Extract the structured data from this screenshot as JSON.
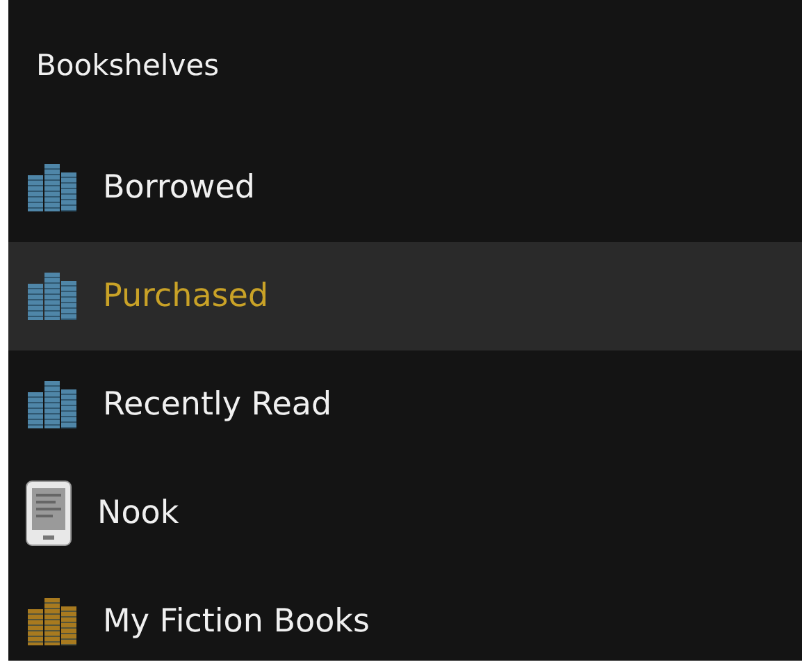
{
  "header": {
    "title": "Bookshelves"
  },
  "items": [
    {
      "label": "Borrowed",
      "kind": "shelf",
      "color": "#4f86a8",
      "selected": false
    },
    {
      "label": "Purchased",
      "kind": "shelf",
      "color": "#4f86a8",
      "selected": true
    },
    {
      "label": "Recently Read",
      "kind": "shelf",
      "color": "#4f86a8",
      "selected": false
    },
    {
      "label": "Nook",
      "kind": "device",
      "selected": false
    },
    {
      "label": "My Fiction Books",
      "kind": "shelf",
      "color": "#a87a1f",
      "selected": false
    }
  ]
}
